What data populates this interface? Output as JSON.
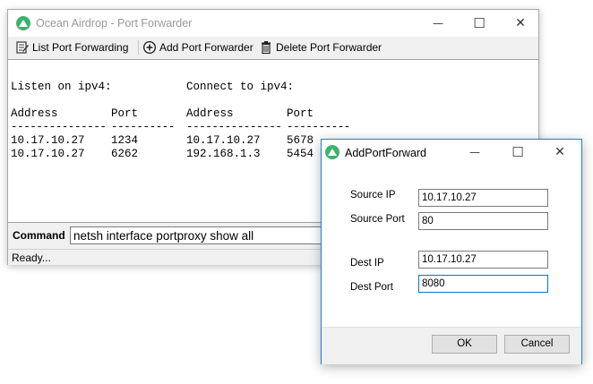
{
  "colors": {
    "app_icon": "#3cb371",
    "accent": "#0078d7",
    "dialog_border": "#1883d7"
  },
  "main_window": {
    "title": "Ocean Airdrop - Port Forwarder",
    "controls": {
      "minimize": "—",
      "maximize": "☐",
      "close": "✕"
    },
    "toolbar": {
      "list_label": "List Port Forwarding",
      "add_label": "Add Port Forwarder",
      "delete_label": "Delete Port Forwarder"
    },
    "output": {
      "heading_listen": "Listen on ipv4:",
      "heading_connect": "Connect to ipv4:",
      "col_address": "Address",
      "col_port": "Port",
      "col_address_2": "Address",
      "col_port_2": "Port",
      "sep_address": "---------------",
      "sep_port": "----------",
      "sep_address_2": "---------------",
      "sep_port_2": "----------",
      "rows": [
        {
          "listen_address": "10.17.10.27",
          "listen_port": "1234",
          "connect_address": "10.17.10.27",
          "connect_port": "5678"
        },
        {
          "listen_address": "10.17.10.27",
          "listen_port": "6262",
          "connect_address": "192.168.1.3",
          "connect_port": "5454"
        }
      ]
    },
    "command": {
      "label": "Command",
      "value": "netsh interface portproxy show all"
    },
    "status": "Ready..."
  },
  "dialog": {
    "title": "AddPortForward",
    "controls": {
      "minimize": "—",
      "maximize": "☐",
      "close": "✕"
    },
    "source_ip_label": "Source IP",
    "source_ip_value": "10.17.10.27",
    "source_port_label": "Source Port",
    "source_port_value": "80",
    "dest_ip_label": "Dest IP",
    "dest_ip_value": "10.17.10.27",
    "dest_port_label": "Dest Port",
    "dest_port_value": "8080",
    "ok_label": "OK",
    "cancel_label": "Cancel"
  }
}
